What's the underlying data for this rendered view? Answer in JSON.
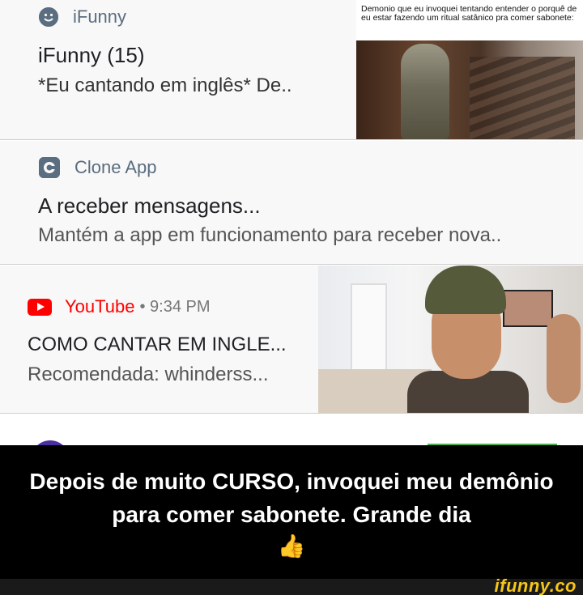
{
  "notifications": [
    {
      "app": "iFunny",
      "title": "iFunny (15)",
      "text": "*Eu cantando em inglês* De..",
      "thumbnail_caption": "Demonio que eu invoquei tentando entender o porquê de eu estar fazendo um ritual satânico pra comer sabonete:"
    },
    {
      "app": "Clone App",
      "title": "A receber mensagens...",
      "text": "Mantém a app em funcionamento para receber nova.."
    },
    {
      "app": "YouTube",
      "time": "• 9:34 PM",
      "title": "COMO CANTAR EM INGLE...",
      "text": "Recomendada: whinderss..."
    }
  ],
  "caption": {
    "text": "Depois de muito CURSO, invoquei meu demônio para comer sabonete. Grande dia",
    "emoji": "👍"
  },
  "watermark": "ifunny.co",
  "colors": {
    "youtube_red": "#ff0000",
    "app_name": "#5b6d80",
    "watermark": "#f5c518"
  },
  "icons": [
    "smiley-icon",
    "clone-app-icon",
    "youtube-icon"
  ]
}
